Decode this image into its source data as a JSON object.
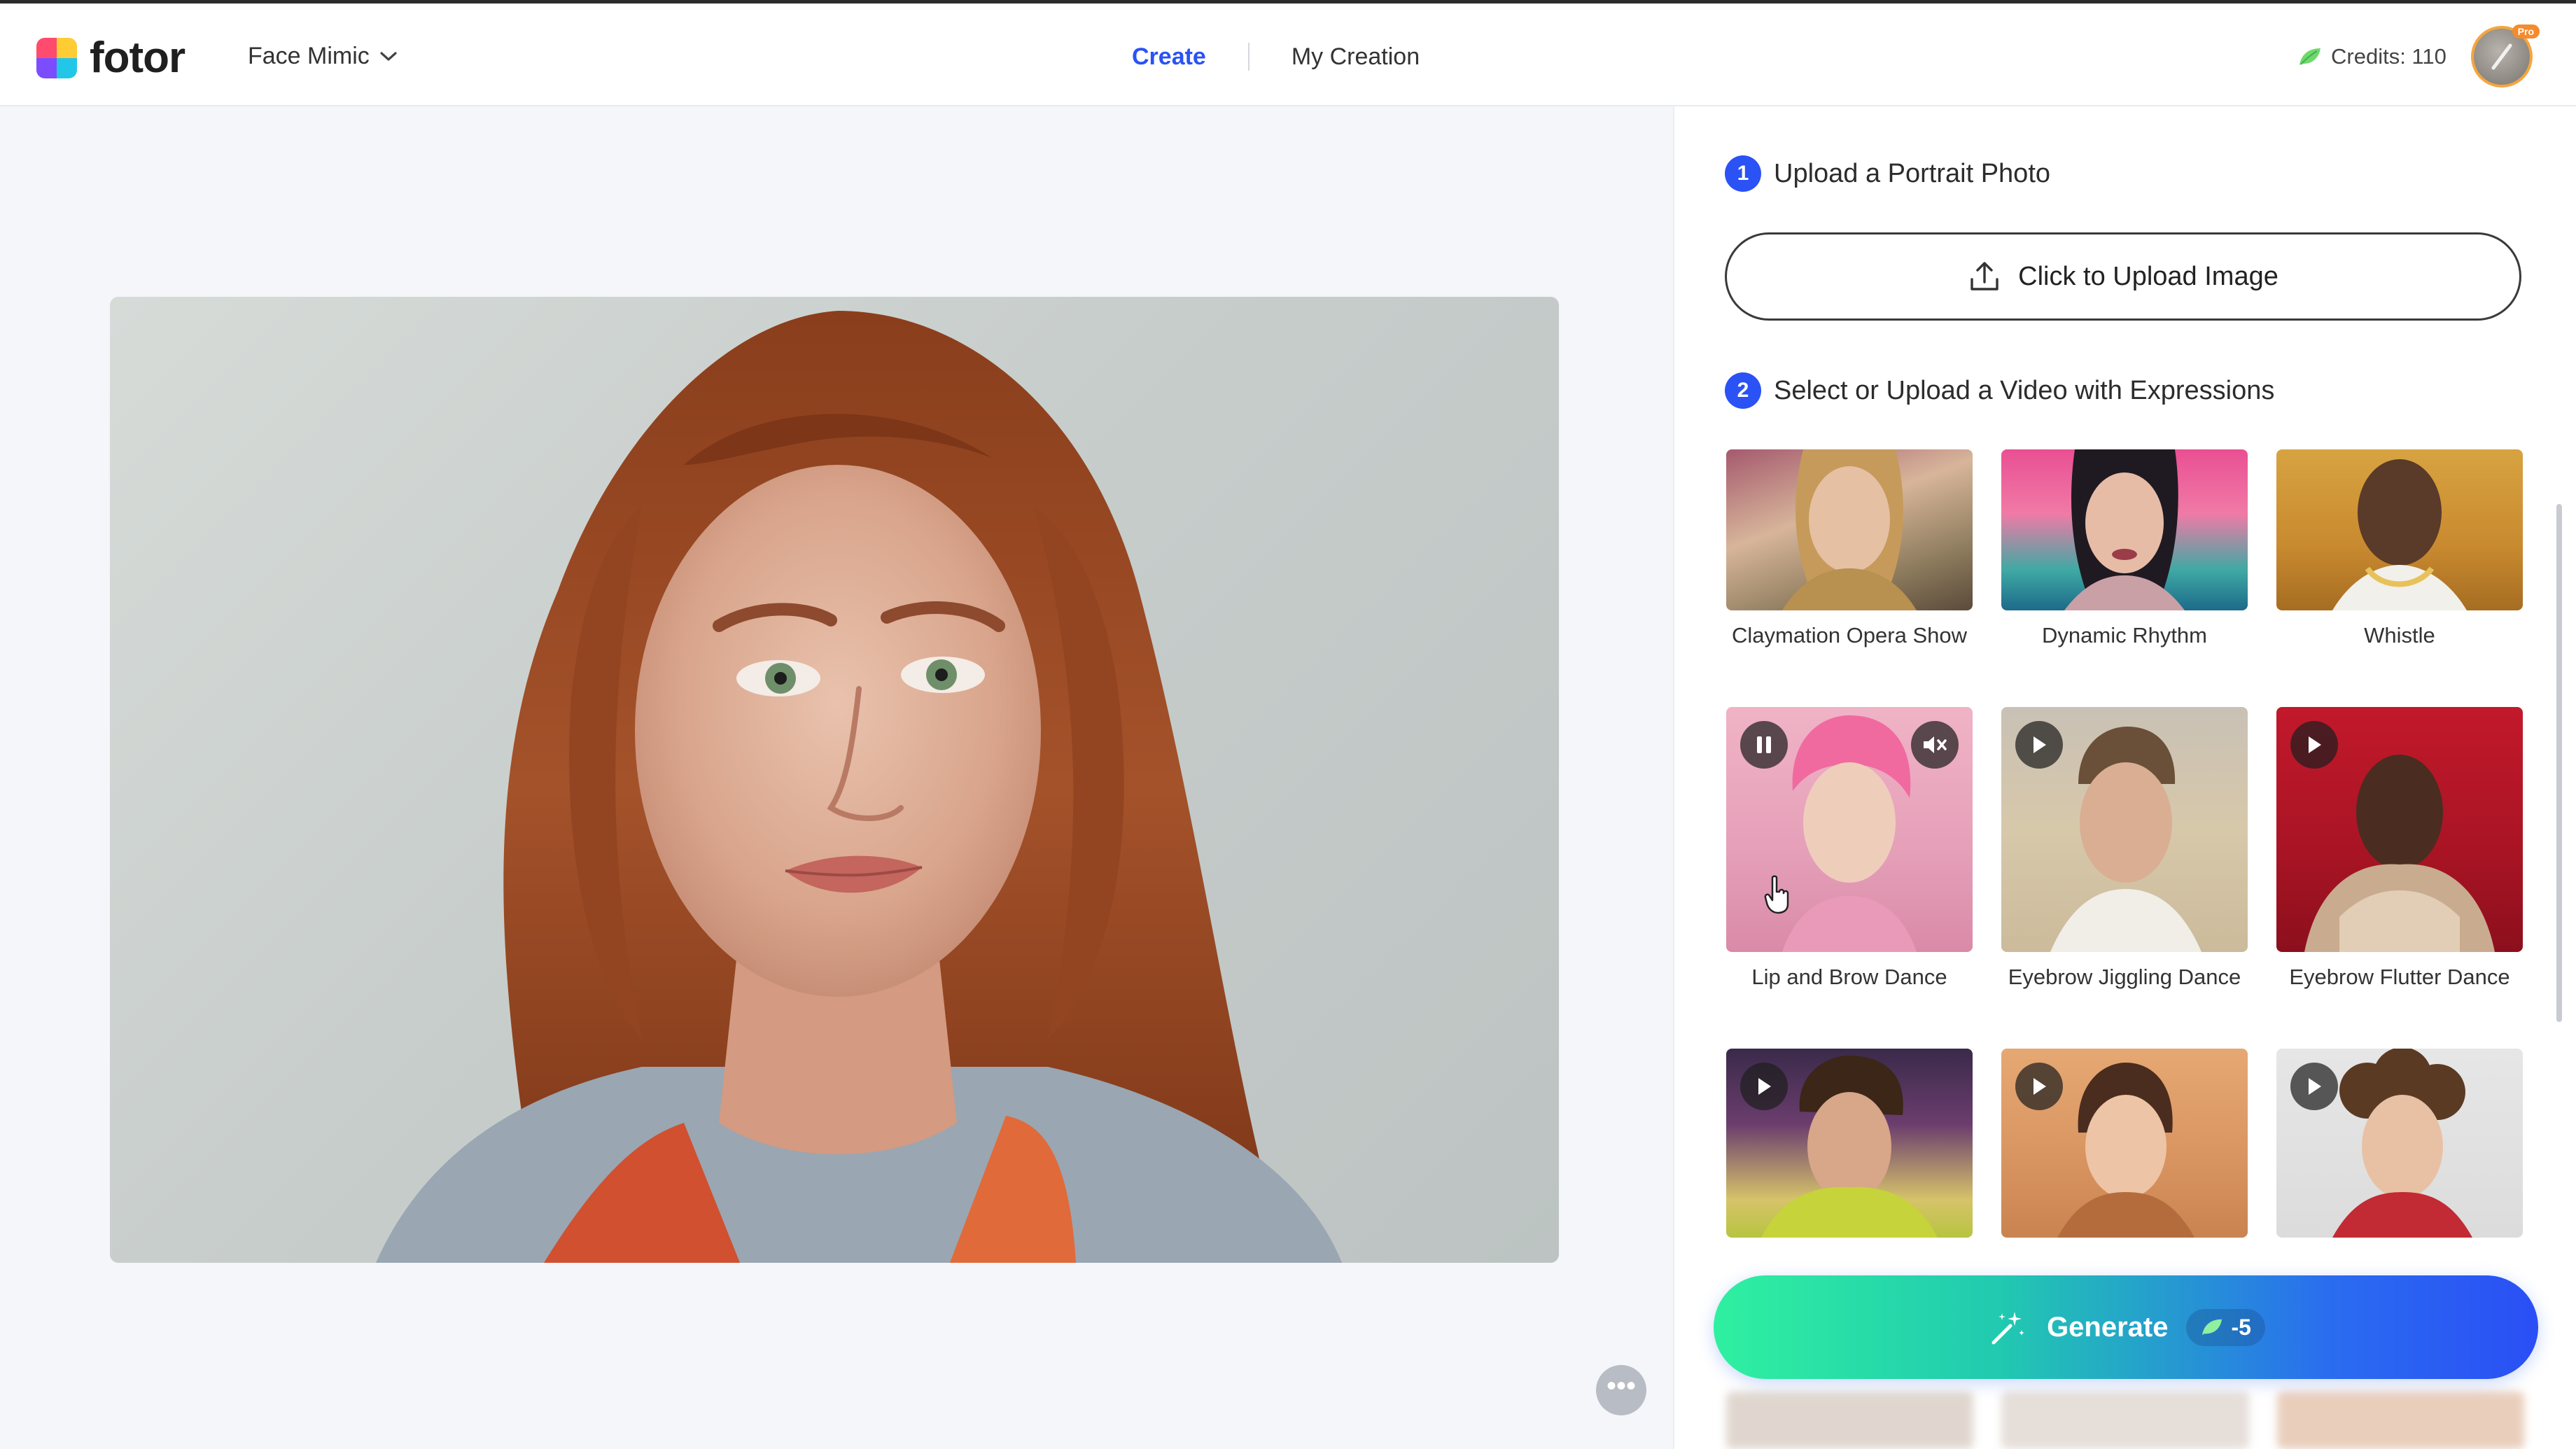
{
  "header": {
    "logo_text": "fotor",
    "tool_name": "Face Mimic",
    "nav": {
      "create": "Create",
      "my_creation": "My Creation"
    },
    "credits_label": "Credits: 110",
    "pro_badge": "Pro"
  },
  "panel": {
    "step1": {
      "number": "1",
      "title": "Upload a Portrait Photo"
    },
    "upload_button": "Click to Upload Image",
    "step2": {
      "number": "2",
      "title": "Select or Upload a Video with Expressions"
    },
    "templates": [
      {
        "label": "Claymation Opera Show",
        "state": "none"
      },
      {
        "label": "Dynamic Rhythm",
        "state": "none"
      },
      {
        "label": "Whistle",
        "state": "none"
      },
      {
        "label": "Lip and Brow Dance",
        "state": "playing"
      },
      {
        "label": "Eyebrow Jiggling Dance",
        "state": "paused"
      },
      {
        "label": "Eyebrow Flutter Dance",
        "state": "paused"
      },
      {
        "label": "",
        "state": "paused"
      },
      {
        "label": "",
        "state": "paused"
      },
      {
        "label": "",
        "state": "paused"
      }
    ],
    "generate_label": "Generate",
    "generate_cost": "-5"
  },
  "canvas": {
    "more_label": "•••"
  },
  "colors": {
    "accent": "#2a52f5",
    "generate_start": "#2ff0a0",
    "generate_end": "#2a4ff5"
  }
}
